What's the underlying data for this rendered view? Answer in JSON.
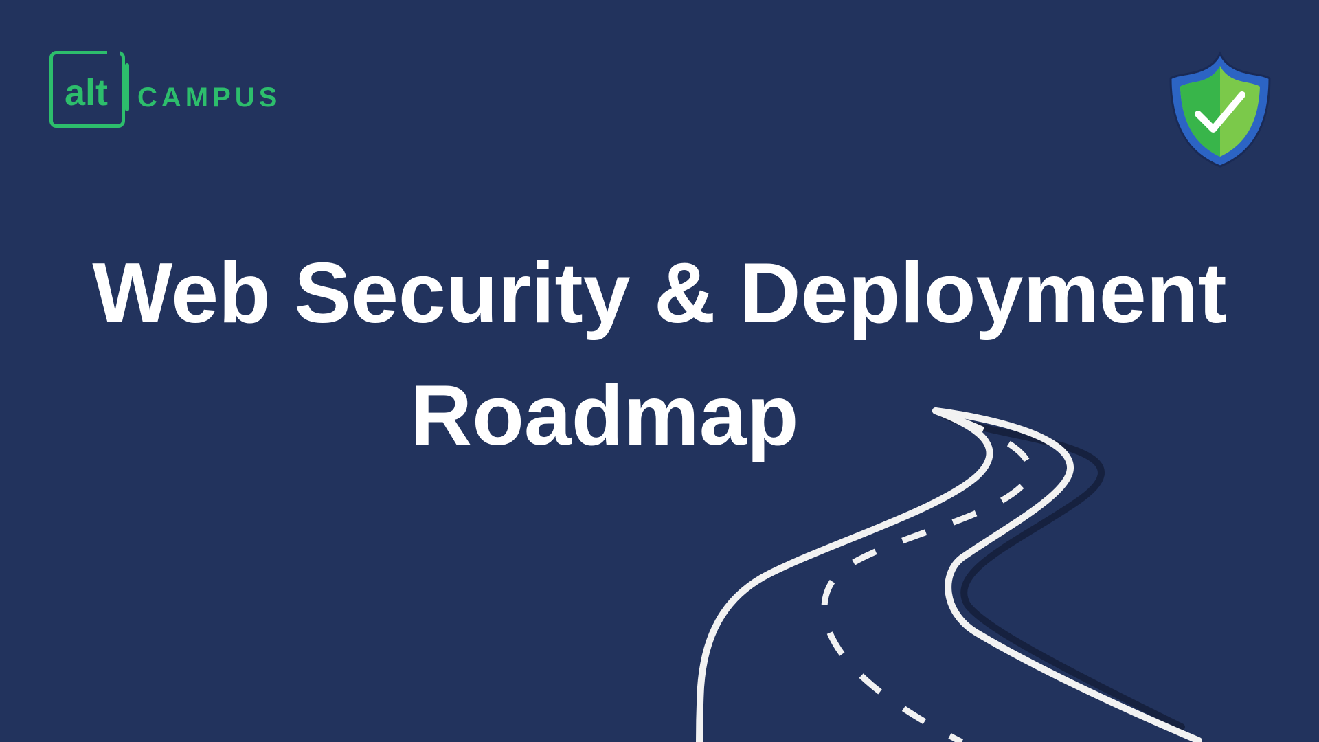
{
  "logo": {
    "alt_text": "alt",
    "campus_text": "CAMPUS",
    "color": "#2dbe6c"
  },
  "badge": {
    "icon": "shield-check-icon",
    "colors": {
      "outer": "#2c64c4",
      "inner_light": "#7bc94a",
      "inner_dark": "#38b54a",
      "check": "#ffffff"
    }
  },
  "title": {
    "line1": "Web Security & Deployment",
    "line2": "Roadmap"
  },
  "decoration": {
    "icon": "road-icon",
    "color": "#f2f2f2"
  },
  "theme": {
    "background": "#22335d",
    "text": "#ffffff"
  }
}
